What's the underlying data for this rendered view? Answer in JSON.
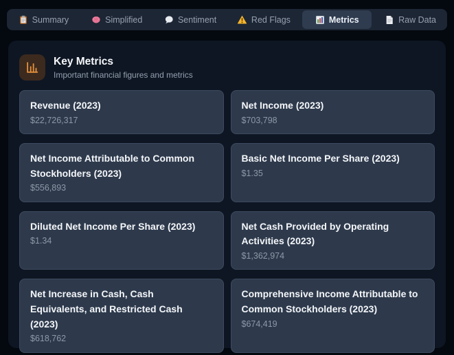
{
  "tabs": [
    {
      "label": "Summary",
      "icon": "clipboard-icon",
      "active": false
    },
    {
      "label": "Simplified",
      "icon": "brain-icon",
      "active": false
    },
    {
      "label": "Sentiment",
      "icon": "speech-balloon-icon",
      "active": false
    },
    {
      "label": "Red Flags",
      "icon": "warning-icon",
      "active": false
    },
    {
      "label": "Metrics",
      "icon": "bar-chart-icon",
      "active": true
    },
    {
      "label": "Raw Data",
      "icon": "page-icon",
      "active": false
    }
  ],
  "header": {
    "title": "Key Metrics",
    "subtitle": "Important financial figures and metrics",
    "icon": "bar-chart-icon"
  },
  "metrics": [
    {
      "label": "Revenue (2023)",
      "value": "$22,726,317"
    },
    {
      "label": "Net Income (2023)",
      "value": "$703,798"
    },
    {
      "label": "Net Income Attributable to Common Stockholders (2023)",
      "value": "$556,893"
    },
    {
      "label": "Basic Net Income Per Share (2023)",
      "value": "$1.35"
    },
    {
      "label": "Diluted Net Income Per Share (2023)",
      "value": "$1.34"
    },
    {
      "label": "Net Cash Provided by Operating Activities (2023)",
      "value": "$1,362,974"
    },
    {
      "label": "Net Increase in Cash, Cash Equivalents, and Restricted Cash (2023)",
      "value": "$618,762"
    },
    {
      "label": "Comprehensive Income Attributable to Common Stockholders (2023)",
      "value": "$674,419"
    }
  ],
  "colors": {
    "accent_orange": "#e5913c",
    "warning_yellow": "#f5b52e",
    "card_bg": "#2e3a4c",
    "panel_bg": "#0e1623",
    "page_bg": "#04080f"
  }
}
